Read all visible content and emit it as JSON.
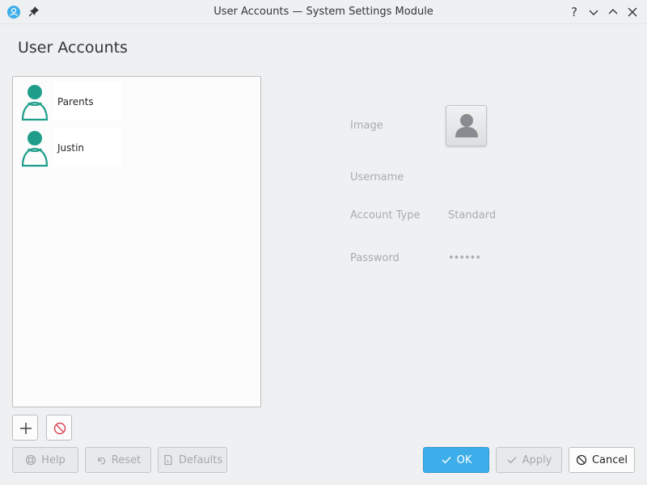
{
  "window": {
    "title": "User Accounts — System Settings Module",
    "help_glyph": "?"
  },
  "page_title": "User Accounts",
  "users": [
    {
      "name": "Parents"
    },
    {
      "name": "Justin"
    }
  ],
  "details": {
    "image_label": "Image",
    "username_label": "Username",
    "account_type_label": "Account Type",
    "account_type_value": "Standard",
    "password_label": "Password",
    "password_value": "••••••"
  },
  "buttons": {
    "help": "Help",
    "reset": "Reset",
    "defaults": "Defaults",
    "ok": "OK",
    "apply": "Apply",
    "cancel": "Cancel"
  },
  "colors": {
    "accent": "#3daee9",
    "avatar": "#1e9e8a",
    "remove": "#da4453"
  }
}
